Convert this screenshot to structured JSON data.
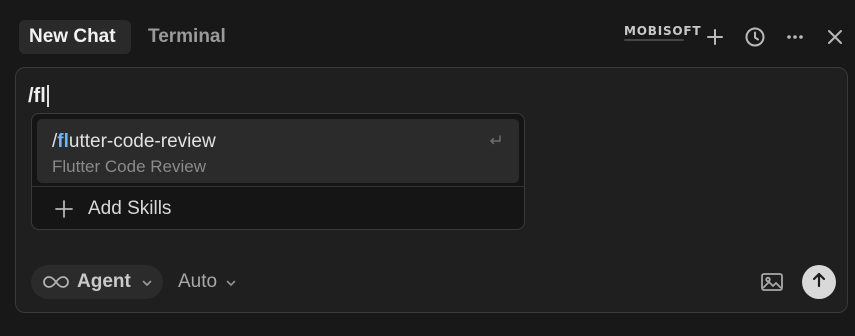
{
  "tabs": {
    "active_label": "New Chat",
    "inactive_label": "Terminal"
  },
  "logo": {
    "text": "MOBISOFT"
  },
  "header_icons": {
    "plus": "plus-icon",
    "history": "history-icon",
    "more": "more-icon",
    "close": "close-icon"
  },
  "input": {
    "value": "/fl"
  },
  "suggestions": {
    "items": [
      {
        "command_prefix": "/",
        "command_match": "fl",
        "command_rest": "utter-code-review",
        "description": "Flutter Code Review",
        "icon": "enter-icon"
      }
    ],
    "add_label": "Add Skills"
  },
  "controls": {
    "agent_label": "Agent",
    "mode_label": "Auto",
    "image_icon": "image-icon",
    "send_icon": "arrow-up-icon"
  },
  "colors": {
    "background": "#181818",
    "panel": "#1f1f1f",
    "match_highlight": "#6fb3ff",
    "send_button": "#d9d9d9"
  }
}
